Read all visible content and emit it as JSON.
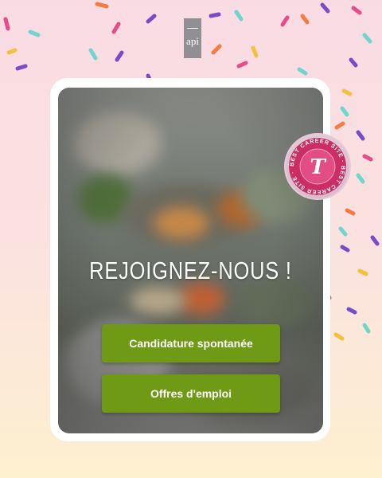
{
  "logo": {
    "text": "api"
  },
  "heading": {
    "text": "REJOIGNEZ-NOUS !"
  },
  "buttons": {
    "spontaneous": "Candidature spontanée",
    "offers": "Offres d'emploi"
  },
  "badge": {
    "ring_text": "BEST CAREER SITE · BEST CAREER SITE ·",
    "letter": "T"
  },
  "colors": {
    "button": "#6f9a16",
    "badge_pink": "#e1427a",
    "background_top": "#f9dbe4",
    "background_bottom": "#fdf0cf"
  }
}
